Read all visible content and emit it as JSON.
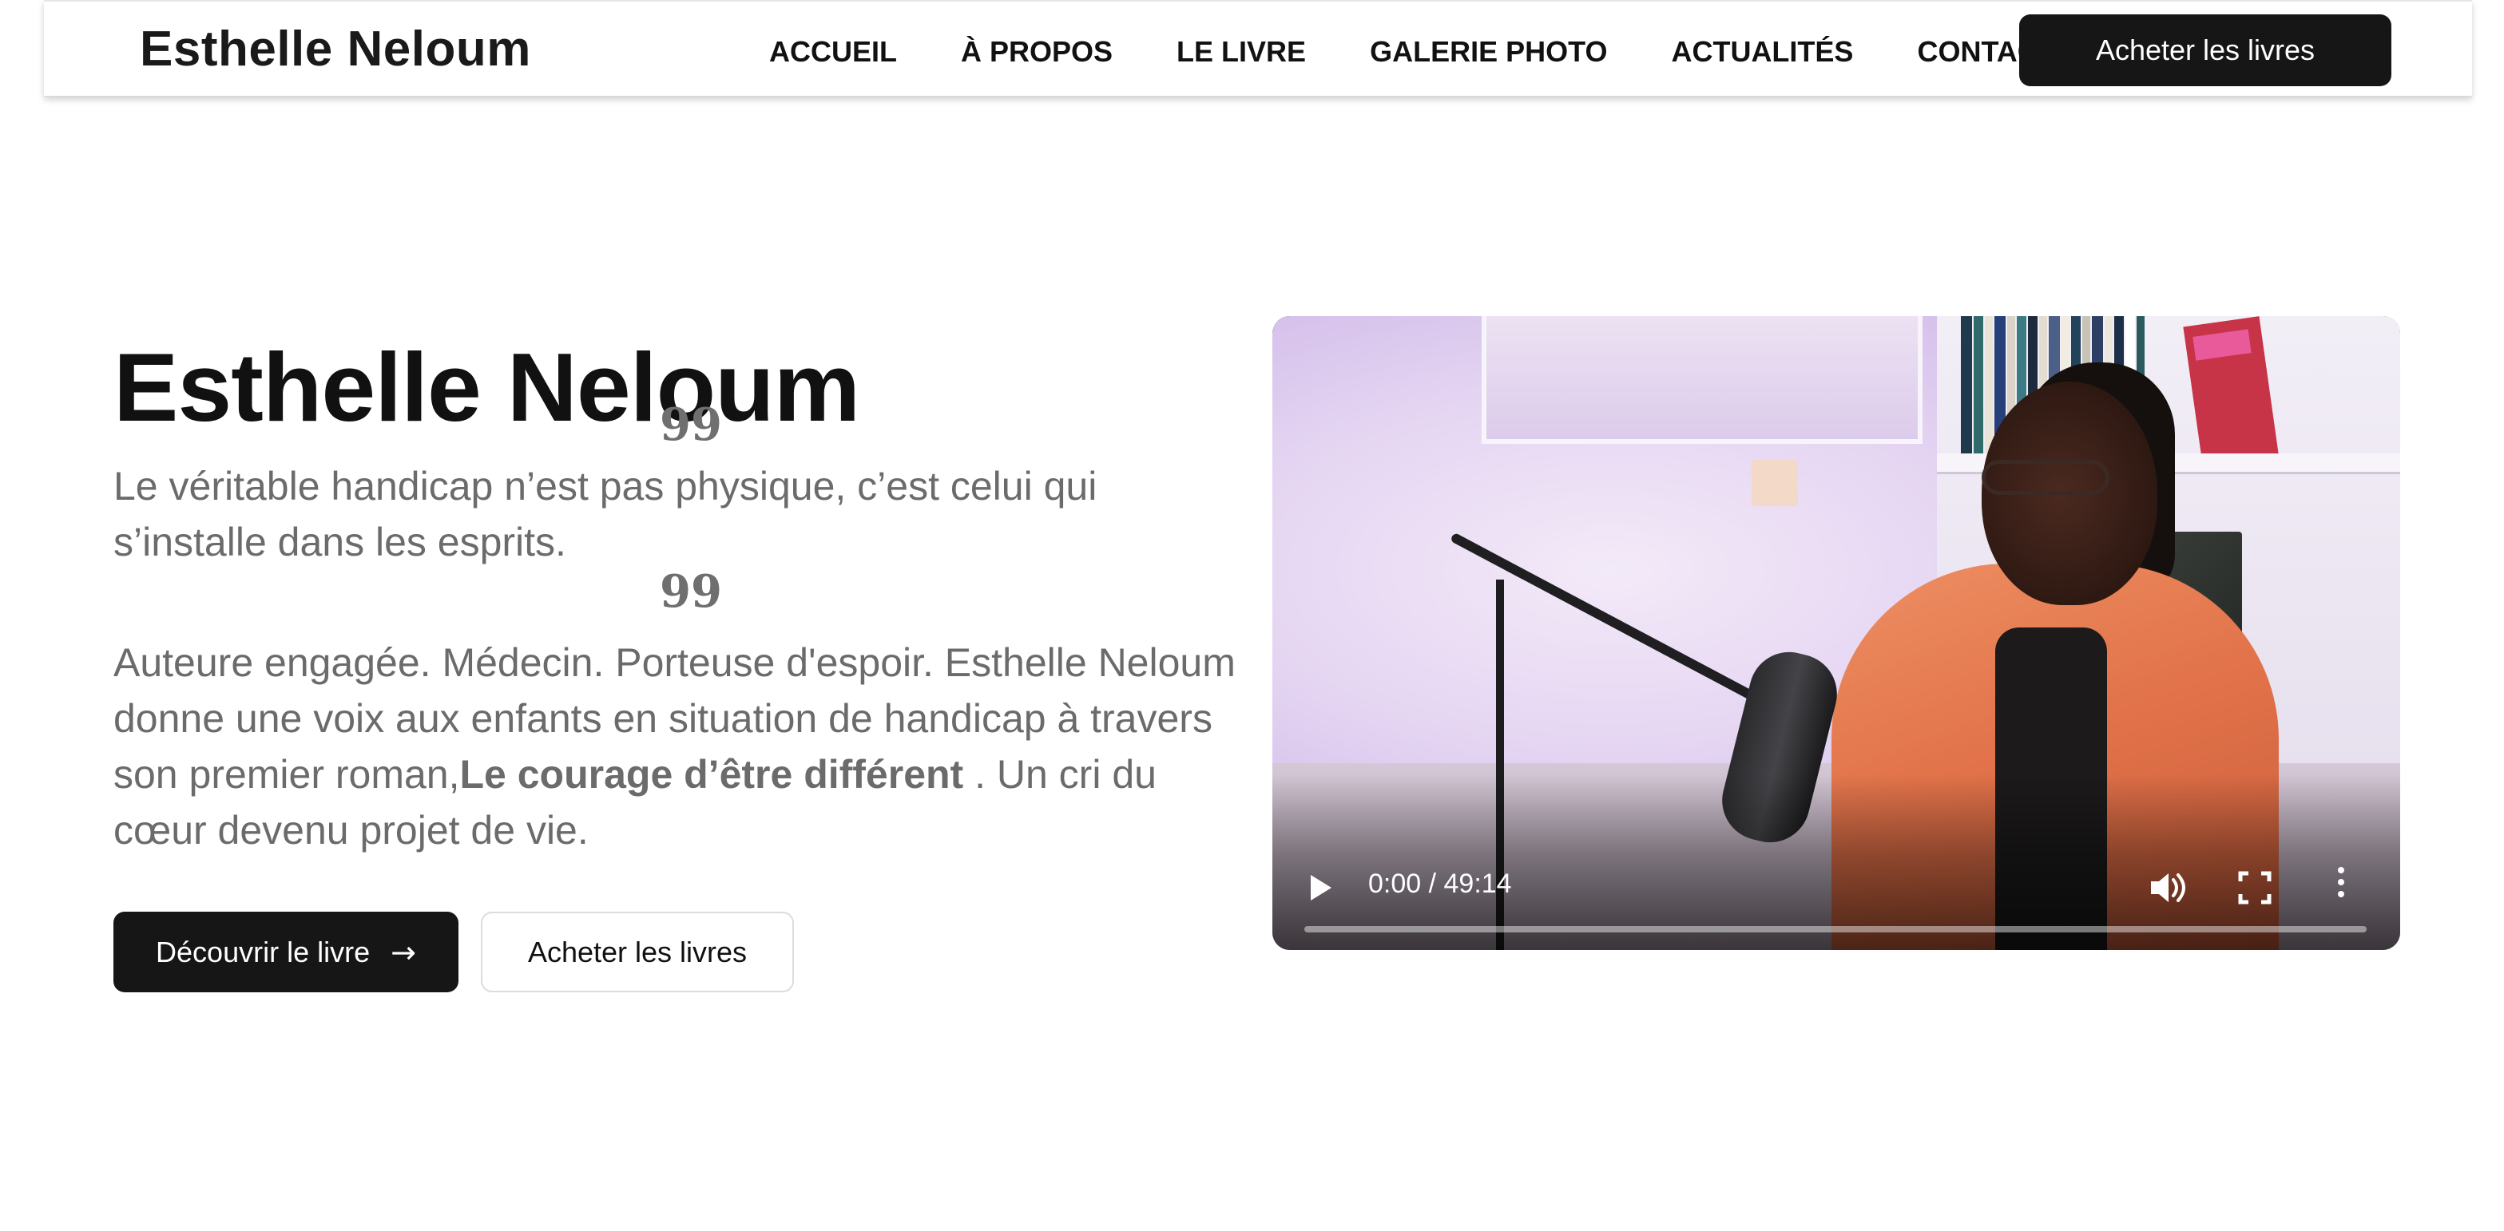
{
  "header": {
    "brand": "Esthelle Neloum",
    "nav": [
      {
        "label": "ACCUEIL"
      },
      {
        "label": "À PROPOS"
      },
      {
        "label": "LE LIVRE"
      },
      {
        "label": "GALERIE PHOTO"
      },
      {
        "label": "ACTUALITÉS"
      },
      {
        "label": "CONTACT"
      }
    ],
    "cta_label": "Acheter les livres"
  },
  "hero": {
    "title": "Esthelle Neloum",
    "quote_mark": "99",
    "quote": "Le véritable handicap n’est pas physique, c’est celui qui s’installe dans les esprits.",
    "intro_before": "Auteure engagée. Médecin. Porteuse d'espoir. Esthelle Neloum donne une voix aux enfants en situation de handicap à travers son premier roman,",
    "intro_book_title": "Le courage d’être différent",
    "intro_after": " . Un cri du cœur devenu projet de vie.",
    "primary_button": "Découvrir le livre",
    "primary_button_arrow": "→",
    "secondary_button": "Acheter les livres"
  },
  "video": {
    "current_time": "0:00",
    "duration": "49:14",
    "time_display": "0:00 / 49:14",
    "progress": 0,
    "icons": {
      "play": "play-icon",
      "volume": "volume-icon",
      "fullscreen": "fullscreen-icon",
      "more": "more-vert-icon"
    }
  },
  "colors": {
    "primary_button_bg": "#161616",
    "text_muted": "#6b6b6b",
    "heading": "#111111"
  }
}
